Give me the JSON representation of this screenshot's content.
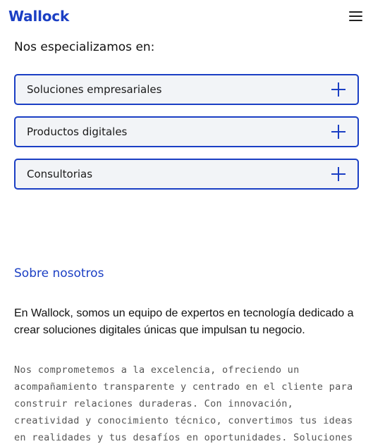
{
  "header": {
    "logo": "Wallock",
    "menu_icon": "hamburger-menu-icon"
  },
  "specialties": {
    "title": "Nos especializamos en:",
    "items": [
      {
        "label": "Soluciones empresariales",
        "icon": "plus-icon"
      },
      {
        "label": "Productos digitales",
        "icon": "plus-icon"
      },
      {
        "label": "Consultorias",
        "icon": "plus-icon"
      }
    ]
  },
  "about": {
    "title": "Sobre nosotros",
    "lead": "En Wallock, somos un equipo de expertos en tecnología dedicado a crear soluciones digitales únicas que impulsan tu negocio.",
    "body": "Nos comprometemos a la excelencia, ofreciendo un acompañamiento transparente y centrado en el cliente para construir relaciones duraderas. Con innovación, creatividad y conocimiento técnico, convertimos tus ideas en realidades y tus desafíos en oportunidades. Soluciones innovadoras y un enfoque"
  },
  "colors": {
    "accent": "#1b3fc4",
    "item_bg": "#f2f4f7",
    "text": "#111111",
    "muted": "#555555"
  }
}
